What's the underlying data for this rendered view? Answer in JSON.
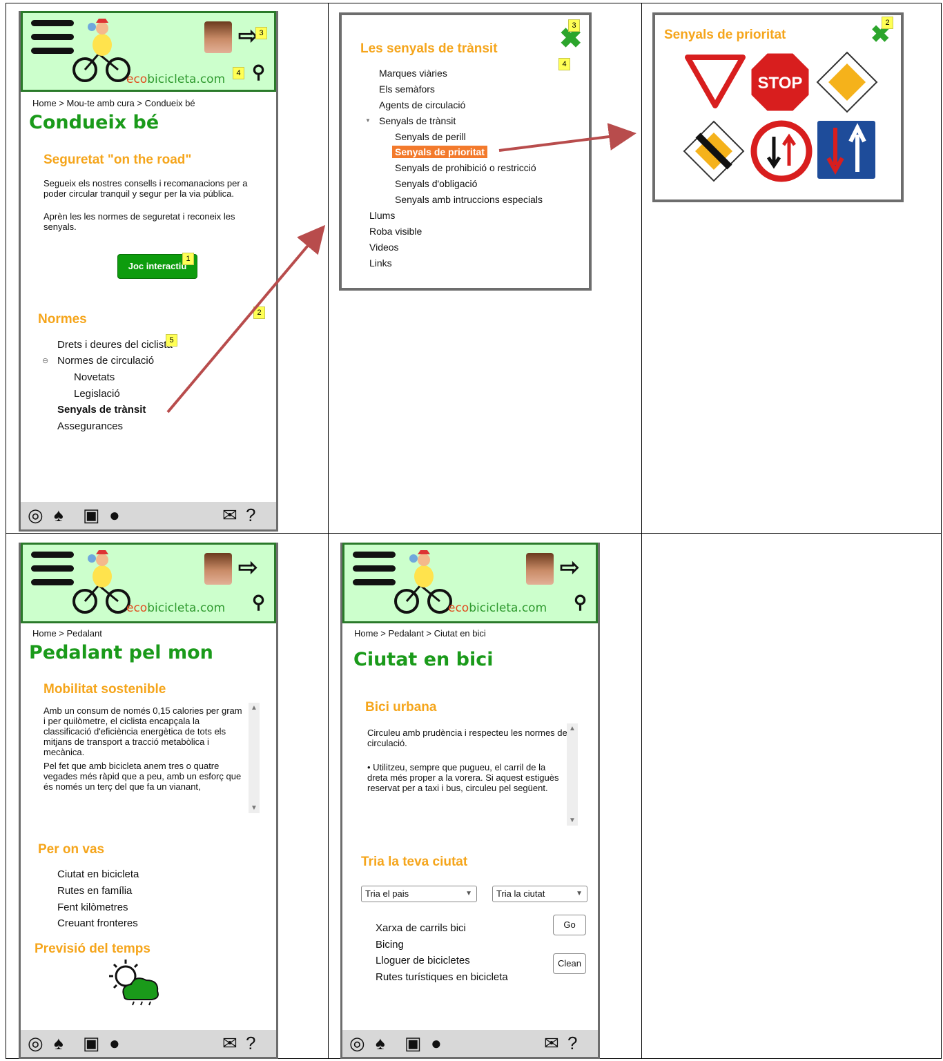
{
  "brand": {
    "logo_prefix": "eco",
    "logo_suffix": "bicicleta.com"
  },
  "icons": [
    "menu-icon",
    "logout-icon",
    "search-icon",
    "instagram-icon",
    "twitter-icon",
    "youtube-icon",
    "spotify-icon",
    "mail-icon",
    "help-icon",
    "close-icon",
    "weather-icon"
  ],
  "colors": {
    "header_bg": "#ccffcc",
    "title_green": "#1a9a1a",
    "section_orange": "#f5a51b",
    "highlight": "#f37a2c",
    "arrow": "#b84c4c"
  },
  "screen1": {
    "breadcrumb": "Home > Mou-te amb cura > Condueix bé",
    "title": "Condueix bé",
    "section1": "Seguretat \"on the road\"",
    "para1": "Segueix els nostres consells i recomanacions per a poder circular tranquil y segur per la via pública.",
    "para2": "Aprèn les les normes de seguretat i reconeix les senyals.",
    "button": "Joc interactiu",
    "section2": "Normes",
    "nav": [
      "Drets i deures del ciclista",
      "Normes de circulació",
      "Novetats",
      "Legislació",
      "Senyals de trànsit",
      "Assegurances"
    ],
    "collapse_glyph": "⊖",
    "badges": [
      "1",
      "2",
      "3",
      "4",
      "5"
    ]
  },
  "screen2": {
    "title": "Les senyals de trànsit",
    "items": [
      "Marques viàries",
      "Els semàfors",
      "Agents de circulació",
      "Senyals de trànsit",
      "Senyals de perill",
      "Senyals de prioritat",
      "Senyals de prohibició o restricció",
      "Senyals d'obligació",
      "Senyals amb intruccions especials",
      "Llums",
      "Roba visible",
      "Videos",
      "Links"
    ],
    "expand_glyph": "▼",
    "badges": [
      "3",
      "4"
    ]
  },
  "screen3": {
    "title": "Senyals de prioritat",
    "stop_text": "STOP",
    "badge": "2"
  },
  "screen4": {
    "breadcrumb": "Home > Pedalant",
    "title": "Pedalant pel mon",
    "section1": "Mobilitat sostenible",
    "para1": " Amb un consum de només 0,15 calories per gram i per quilòmetre, el ciclista encapçala la classificació d'eficiència energètica de tots els mitjans de transport a tracció metabòlica i mecànica.",
    "para2": "Pel fet que amb bicicleta anem tres o quatre vegades més ràpid que a peu, amb un esforç que és només un terç del que fa un vianant,",
    "section2": "Per on vas",
    "nav": [
      "Ciutat en bicicleta",
      "Rutes en família",
      "Fent kilòmetres",
      "Creuant fronteres"
    ],
    "section3": "Previsió del temps"
  },
  "screen5": {
    "breadcrumb": "Home > Pedalant > Ciutat en bici",
    "title": "Ciutat en bici",
    "section1": "Bici urbana",
    "para1": "Circuleu amb prudència i respecteu les normes de circulació.",
    "para2": "• Utilitzeu, sempre que pugueu, el carril de la dreta més proper a la vorera. Si aquest estiguès reservat per a taxi i bus, circuleu pel següent.",
    "section2": "Tria la teva ciutat",
    "select_country": "Tria el pais",
    "select_city": "Tria la ciutat",
    "go": "Go",
    "clean": "Clean",
    "nav": [
      "Xarxa de carrils bici",
      "Bicing",
      "Lloguer de bicicletes",
      "Rutes turístiques en bicicleta"
    ]
  }
}
